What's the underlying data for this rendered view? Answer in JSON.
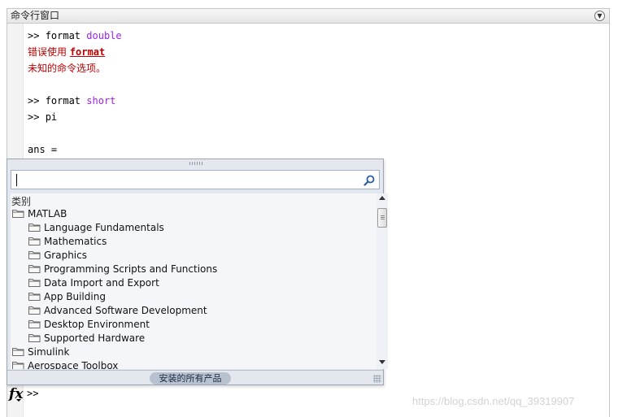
{
  "window": {
    "title": "命令行窗口",
    "collapse_icon": "chevron-down-circle-icon"
  },
  "console": {
    "line1": {
      "prompt": ">> ",
      "cmd": "format ",
      "arg": "double"
    },
    "line2": {
      "text": "错误使用 ",
      "link": "format"
    },
    "line3": {
      "text": "未知的命令选项。"
    },
    "line4": {
      "prompt": ">> ",
      "cmd": "format ",
      "arg": "short"
    },
    "line5": {
      "prompt": ">> ",
      "cmd": "pi"
    },
    "line6": {
      "text": "ans ="
    }
  },
  "function_browser": {
    "search": {
      "value": "",
      "placeholder": ""
    },
    "category_header": "类别",
    "tree": [
      {
        "label": "MATLAB",
        "level": 0
      },
      {
        "label": "Language Fundamentals",
        "level": 1
      },
      {
        "label": "Mathematics",
        "level": 1
      },
      {
        "label": "Graphics",
        "level": 1
      },
      {
        "label": "Programming Scripts and Functions",
        "level": 1
      },
      {
        "label": "Data Import and Export",
        "level": 1
      },
      {
        "label": "App Building",
        "level": 1
      },
      {
        "label": "Advanced Software Development",
        "level": 1
      },
      {
        "label": "Desktop Environment",
        "level": 1
      },
      {
        "label": "Supported Hardware",
        "level": 1
      },
      {
        "label": "Simulink",
        "level": 0
      },
      {
        "label": "Aerospace Toolbox",
        "level": 0
      }
    ],
    "footer_button": "安装的所有产品"
  },
  "prompt_line": {
    "fx_label": "fx",
    "prompt": ">>"
  },
  "watermark": "https://blog.csdn.net/qq_39319907",
  "colors": {
    "keyword": "#a020f0",
    "error": "#c00000",
    "popup_bg": "#e4e8ee"
  }
}
